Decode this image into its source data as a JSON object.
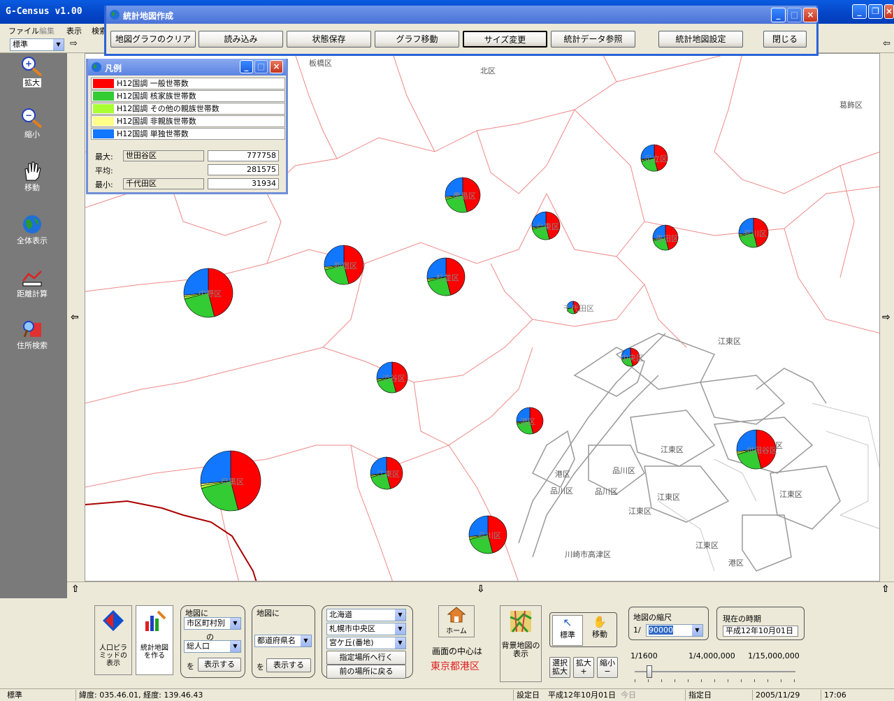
{
  "app": {
    "title": "G-Census v1.00"
  },
  "menu": [
    "ファイル",
    "編集",
    "表示",
    "検索"
  ],
  "toolbar": {
    "style_select": "標準"
  },
  "tools": [
    "拡大",
    "縮小",
    "移動",
    "全体表示",
    "距離計算",
    "住所検索"
  ],
  "stat_window": {
    "title": "統計地図作成",
    "buttons": [
      "地図グラフのクリア",
      "読み込み",
      "状態保存",
      "グラフ移動",
      "サイズ変更",
      "統計データ参照",
      "統計地図設定",
      "閉じる"
    ]
  },
  "legend": {
    "title": "凡例",
    "items": [
      {
        "label": "H12国調 一般世帯数",
        "color": "#ff0000"
      },
      {
        "label": "H12国調 核家族世帯数",
        "color": "#33cc33"
      },
      {
        "label": "H12国調 その他の親族世帯数",
        "color": "#aaff33"
      },
      {
        "label": "H12国調 非親族世帯数",
        "color": "#ffff88"
      },
      {
        "label": "H12国調 単独世帯数",
        "color": "#1177ff"
      }
    ],
    "max_label": "最大:",
    "max_name": "世田谷区",
    "max_value": "777758",
    "avg_label": "平均:",
    "avg_value": "281575",
    "min_label": "最小:",
    "min_name": "千代田区",
    "min_value": "31934"
  },
  "map_labels": [
    "板橋区",
    "北区",
    "葛飾区",
    "江東区",
    "江東区",
    "江東区",
    "江東区",
    "江東区",
    "江東区",
    "江東区",
    "港区",
    "港区",
    "品川区",
    "品川区",
    "品川区",
    "川崎市高津区"
  ],
  "wards": [
    "足立区",
    "豊島区",
    "台東区",
    "墨田区",
    "荒川区",
    "中野区",
    "新宿区",
    "杉並区",
    "千代田区",
    "中央区",
    "渋谷区",
    "港区",
    "世田谷区",
    "目黒区",
    "江東区",
    "品川区"
  ],
  "bottom": {
    "pyramid": "人口ピラミッドの表示",
    "make_map": "統計地図を作る",
    "grp1_title": "地図に",
    "grp1_select": "市区町村別",
    "grp1_no": "の",
    "grp1_select2": "総人口",
    "grp1_wo": "を",
    "grp1_btn": "表示する",
    "grp2_title": "地図に",
    "grp2_select": "都道府県名",
    "grp2_wo": "を",
    "grp2_btn": "表示する",
    "loc_pref": "北海道",
    "loc_city": "札幌市中央区",
    "loc_town": "宮ケ丘(番地)",
    "goto": "指定場所へ行く",
    "back": "前の場所に戻る",
    "home": "ホーム",
    "center_label": "画面の中心は",
    "center_value": "東京都港区",
    "bg_map": "背景地図の表示",
    "std": "標準",
    "move": "移動",
    "sel_zoom": "選択拡大",
    "zoom_in": "拡大+",
    "zoom_out": "縮小−",
    "scale_title": "地図の縮尺",
    "scale_prefix": "1/",
    "scale_value": "90000",
    "scale_ticks": [
      "1/1600",
      "1/4,000,000",
      "1/15,000,000"
    ],
    "period_title": "現在の時期",
    "period_value": "平成12年10月01日"
  },
  "status": {
    "mode": "標準",
    "coords": "緯度: 035.46.01, 経度: 139.46.43",
    "set_date_label": "設定日",
    "set_date": "平成12年10月01日",
    "today": "今日",
    "specified": "指定日",
    "date": "2005/11/29",
    "time": "17:06"
  }
}
